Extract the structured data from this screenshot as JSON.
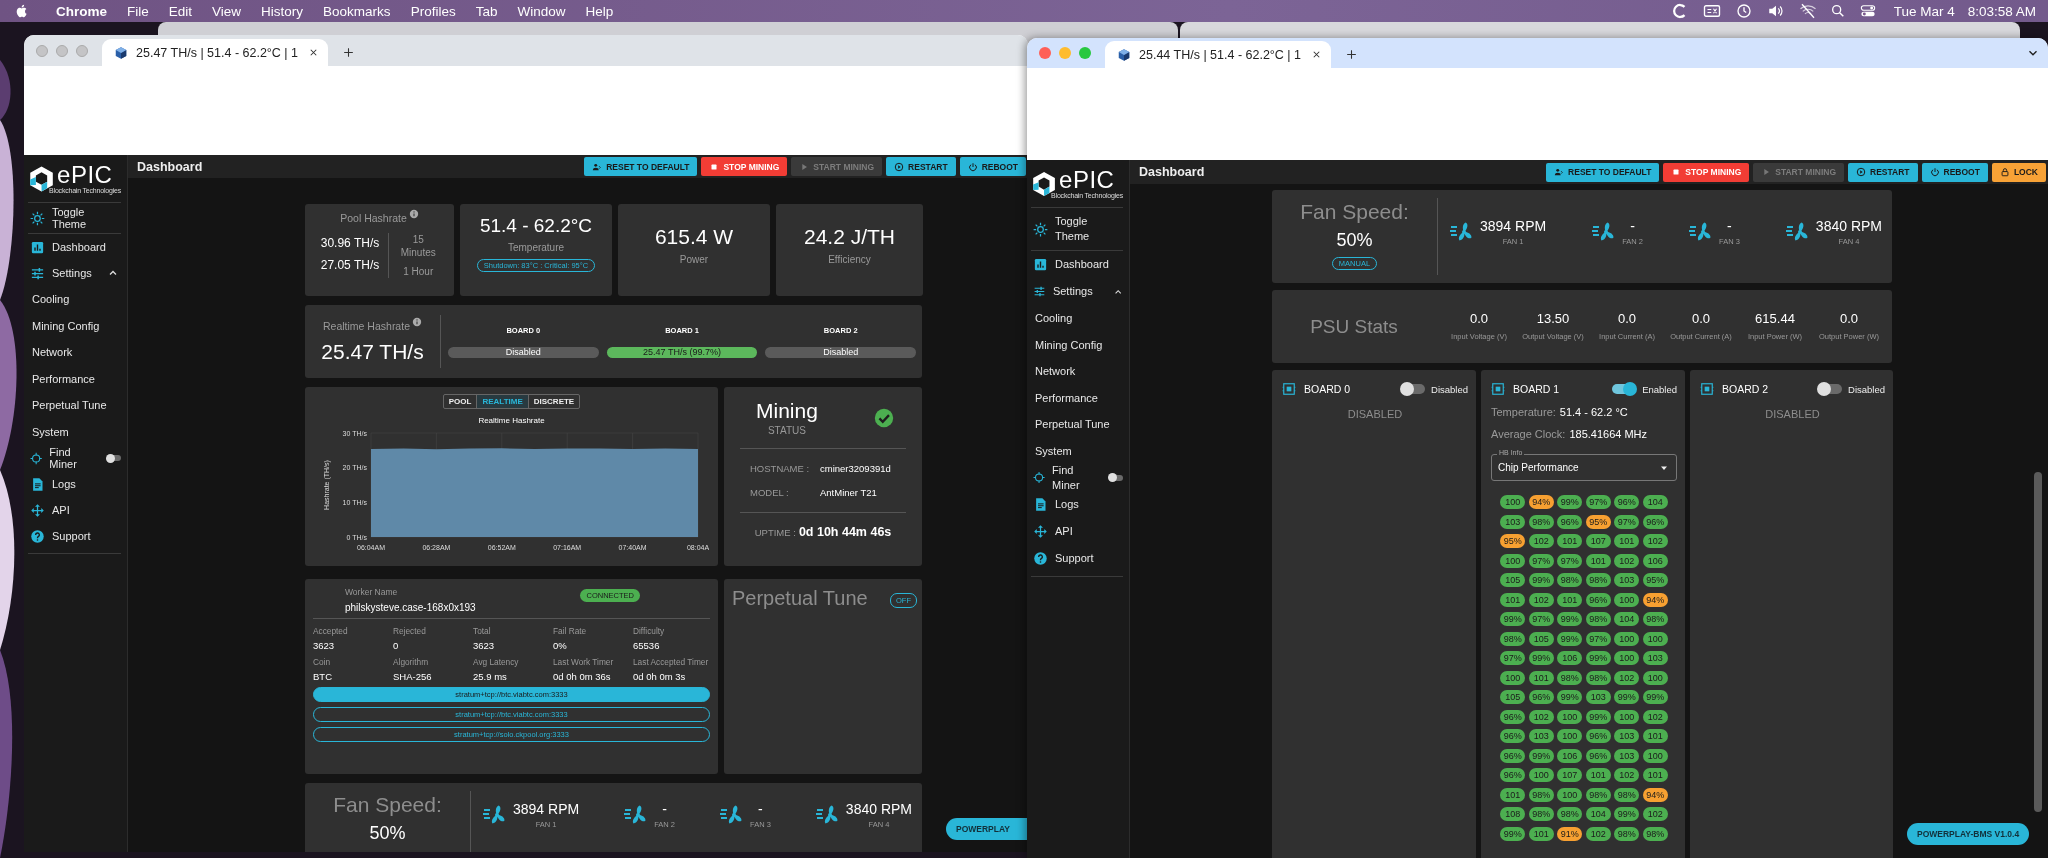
{
  "menu_bar": {
    "app_name": "Chrome",
    "menus": [
      "File",
      "Edit",
      "View",
      "History",
      "Bookmarks",
      "Profiles",
      "Tab",
      "Window",
      "Help"
    ],
    "date": "Tue Mar 4",
    "time": "8:03:58 AM"
  },
  "left_window": {
    "active": false,
    "tab_title": "25.47 TH/s | 51.4 - 62.2°C | 1",
    "app": {
      "logo": "ePIC",
      "logo_tagline": "Blockchain Technologies",
      "page_title": "Dashboard",
      "buttons": [
        {
          "label": "RESET TO DEFAULT",
          "kind": "primary"
        },
        {
          "label": "STOP MINING",
          "kind": "danger"
        },
        {
          "label": "START MINING",
          "kind": "disabled"
        },
        {
          "label": "RESTART",
          "kind": "primary"
        },
        {
          "label": "REBOOT",
          "kind": "primary"
        }
      ],
      "sidebar": [
        {
          "label": "Toggle Theme",
          "kind": "link"
        },
        {
          "label": "Dashboard",
          "kind": "link"
        },
        {
          "label": "Settings",
          "kind": "group",
          "expanded": true,
          "children": [
            {
              "label": "Cooling"
            },
            {
              "label": "Mining Config"
            },
            {
              "label": "Network"
            },
            {
              "label": "Performance"
            },
            {
              "label": "Perpetual Tune"
            },
            {
              "label": "System"
            }
          ]
        },
        {
          "label": "Find Miner",
          "kind": "toggle",
          "on": false
        },
        {
          "label": "Logs",
          "kind": "link"
        },
        {
          "label": "API",
          "kind": "link"
        },
        {
          "label": "Support",
          "kind": "link"
        }
      ],
      "pool_hashrate": {
        "label": "Pool Hashrate",
        "values": [
          "30.96 TH/s",
          "27.05 TH/s"
        ],
        "periods": [
          "15 Minutes",
          "1 Hour"
        ]
      },
      "temperature": {
        "value": "51.4 - 62.2°C",
        "label": "Temperature",
        "limits": "Shutdown: 83°C : Critical: 95°C"
      },
      "power": {
        "value": "615.4 W",
        "label": "Power"
      },
      "efficiency": {
        "value": "24.2 J/TH",
        "label": "Efficiency"
      },
      "realtime_hashrate": {
        "label": "Realtime Hashrate",
        "value": "25.47 TH/s",
        "boards": [
          {
            "name": "BOARD 0",
            "status": "Disabled",
            "enabled": false
          },
          {
            "name": "BOARD 1",
            "status": "25.47 TH/s (99.7%)",
            "enabled": true
          },
          {
            "name": "BOARD 2",
            "status": "Disabled",
            "enabled": false
          }
        ]
      },
      "chart_tabs": [
        {
          "label": "POOL",
          "selected": false
        },
        {
          "label": "REALTIME",
          "selected": true
        },
        {
          "label": "DISCRETE",
          "selected": false
        }
      ],
      "chart_data": {
        "type": "area",
        "title": "Realtime Hashrate",
        "ylabel": "Hashrate (TH/s)",
        "categories": [
          "06:04AM",
          null,
          "06:28AM",
          null,
          "06:52AM",
          null,
          "07:16AM",
          null,
          "07:40AM",
          null,
          "08:04A"
        ],
        "series": [
          {
            "color": "#5f89a8",
            "values": [
              25.4,
              25.5,
              25.3,
              25.5,
              25.6,
              25.4,
              25.5,
              25.5,
              25.4,
              25.5,
              25.4
            ]
          }
        ],
        "ylim": [
          0,
          30
        ],
        "grid": true,
        "yticks": [
          {
            "value": 0,
            "label": "0 TH/s"
          },
          {
            "value": 10,
            "label": "10 TH/s"
          },
          {
            "value": 20,
            "label": "20 TH/s"
          },
          {
            "value": 30,
            "label": "30 TH/s"
          }
        ]
      },
      "status": {
        "state": "Mining",
        "label": "STATUS",
        "ok": true,
        "hostname_label": "HOSTNAME :",
        "hostname": "cminer3209391d",
        "model_label": "MODEL :",
        "model": "AntMiner T21",
        "uptime_label": "UPTIME :",
        "uptime": "0d 10h 44m 46s"
      },
      "worker": {
        "label": "Worker Name",
        "name": "philskysteve.case-168x0x193",
        "connection": "CONNECTED",
        "connected": true,
        "stats": [
          {
            "label": "Accepted",
            "value": "3623"
          },
          {
            "label": "Rejected",
            "value": "0"
          },
          {
            "label": "Total",
            "value": "3623"
          },
          {
            "label": "Fail Rate",
            "value": "0%"
          },
          {
            "label": "Difficulty",
            "value": "65536"
          },
          {
            "label": "Coin",
            "value": "BTC"
          },
          {
            "label": "Algorithm",
            "value": "SHA-256"
          },
          {
            "label": "Avg Latency",
            "value": "25.9 ms"
          },
          {
            "label": "Last Work Timer",
            "value": "0d 0h 0m 36s"
          },
          {
            "label": "Last Accepted Timer",
            "value": "0d 0h 0m 3s"
          }
        ],
        "pools": [
          {
            "url": "stratum+tcp://btc.viabtc.com:3333",
            "selected": true
          },
          {
            "url": "stratum+tcp://btc.viabtc.com:3333",
            "selected": false
          },
          {
            "url": "stratum+tcp://solo.ckpool.org:3333",
            "selected": false
          }
        ]
      },
      "perpetual_tune": {
        "title": "Perpetual Tune",
        "state": "OFF",
        "on": false
      },
      "fans": {
        "title": "Fan Speed:",
        "value": "50%",
        "units": [
          {
            "rpm": "3894 RPM",
            "name": "FAN 1"
          },
          {
            "rpm": "-",
            "name": "FAN 2"
          },
          {
            "rpm": "-",
            "name": "FAN 3"
          },
          {
            "rpm": "3840 RPM",
            "name": "FAN 4"
          }
        ]
      },
      "version_badge": "POWERPLAY"
    }
  },
  "right_window": {
    "active": true,
    "tab_title": "25.44 TH/s | 51.4 - 62.2°C | 1",
    "app": {
      "logo": "ePIC",
      "logo_tagline": "Blockchain Technologies",
      "page_title": "Dashboard",
      "buttons": [
        {
          "label": "RESET TO DEFAULT",
          "kind": "primary"
        },
        {
          "label": "STOP MINING",
          "kind": "danger"
        },
        {
          "label": "START MINING",
          "kind": "disabled"
        },
        {
          "label": "RESTART",
          "kind": "primary"
        },
        {
          "label": "REBOOT",
          "kind": "primary"
        },
        {
          "label": "LOCK",
          "kind": "warning"
        }
      ],
      "sidebar": [
        {
          "label": "Toggle Theme",
          "kind": "link"
        },
        {
          "label": "Dashboard",
          "kind": "link"
        },
        {
          "label": "Settings",
          "kind": "group",
          "expanded": true,
          "children": [
            {
              "label": "Cooling"
            },
            {
              "label": "Mining Config"
            },
            {
              "label": "Network"
            },
            {
              "label": "Performance"
            },
            {
              "label": "Perpetual Tune"
            },
            {
              "label": "System"
            }
          ]
        },
        {
          "label": "Find Miner",
          "kind": "toggle",
          "on": false
        },
        {
          "label": "Logs",
          "kind": "link"
        },
        {
          "label": "API",
          "kind": "link"
        },
        {
          "label": "Support",
          "kind": "link"
        }
      ],
      "fans": {
        "title": "Fan Speed:",
        "value": "50%",
        "mode": "MANUAL",
        "units": [
          {
            "rpm": "3894 RPM",
            "name": "FAN 1"
          },
          {
            "rpm": "-",
            "name": "FAN 2"
          },
          {
            "rpm": "-",
            "name": "FAN 3"
          },
          {
            "rpm": "3840 RPM",
            "name": "FAN 4"
          }
        ]
      },
      "psu": {
        "title": "PSU Stats",
        "stats": [
          {
            "value": "0.0",
            "label": "Input Voltage (V)"
          },
          {
            "value": "13.50",
            "label": "Output Voltage (V)"
          },
          {
            "value": "0.0",
            "label": "Input Current (A)"
          },
          {
            "value": "0.0",
            "label": "Output Current (A)"
          },
          {
            "value": "615.44",
            "label": "Input Power (W)"
          },
          {
            "value": "0.0",
            "label": "Output Power (W)"
          }
        ]
      },
      "boards": [
        {
          "name": "BOARD 0",
          "enabled": false,
          "toggle_label": "Disabled",
          "message": "DISABLED"
        },
        {
          "name": "BOARD 1",
          "enabled": true,
          "toggle_label": "Enabled",
          "temperature_label": "Temperature:",
          "temperature": "51.4 - 62.2 °C",
          "clock_label": "Average Clock:",
          "clock": "185.41664 MHz",
          "select_label": "HB Info",
          "select_value": "Chip Performance",
          "chips": [
            [
              {
                "value": "100",
                "low": false
              },
              {
                "value": "94%",
                "low": true
              },
              {
                "value": "99%",
                "low": false
              },
              {
                "value": "97%",
                "low": false
              },
              {
                "value": "96%",
                "low": false
              },
              {
                "value": "104",
                "low": false
              }
            ],
            [
              {
                "value": "103",
                "low": false
              },
              {
                "value": "98%",
                "low": false
              },
              {
                "value": "96%",
                "low": false
              },
              {
                "value": "95%",
                "low": true
              },
              {
                "value": "97%",
                "low": false
              },
              {
                "value": "96%",
                "low": false
              }
            ],
            [
              {
                "value": "95%",
                "low": true
              },
              {
                "value": "102",
                "low": false
              },
              {
                "value": "101",
                "low": false
              },
              {
                "value": "107",
                "low": false
              },
              {
                "value": "101",
                "low": false
              },
              {
                "value": "102",
                "low": false
              }
            ],
            [
              {
                "value": "100",
                "low": false
              },
              {
                "value": "97%",
                "low": false
              },
              {
                "value": "97%",
                "low": false
              },
              {
                "value": "101",
                "low": false
              },
              {
                "value": "102",
                "low": false
              },
              {
                "value": "106",
                "low": false
              }
            ],
            [
              {
                "value": "105",
                "low": false
              },
              {
                "value": "99%",
                "low": false
              },
              {
                "value": "98%",
                "low": false
              },
              {
                "value": "98%",
                "low": false
              },
              {
                "value": "103",
                "low": false
              },
              {
                "value": "95%",
                "low": false
              }
            ],
            [
              {
                "value": "101",
                "low": false
              },
              {
                "value": "102",
                "low": false
              },
              {
                "value": "101",
                "low": false
              },
              {
                "value": "96%",
                "low": false
              },
              {
                "value": "100",
                "low": false
              },
              {
                "value": "94%",
                "low": true
              }
            ],
            [
              {
                "value": "99%",
                "low": false
              },
              {
                "value": "97%",
                "low": false
              },
              {
                "value": "99%",
                "low": false
              },
              {
                "value": "98%",
                "low": false
              },
              {
                "value": "104",
                "low": false
              },
              {
                "value": "98%",
                "low": false
              }
            ],
            [
              {
                "value": "98%",
                "low": false
              },
              {
                "value": "105",
                "low": false
              },
              {
                "value": "99%",
                "low": false
              },
              {
                "value": "97%",
                "low": false
              },
              {
                "value": "100",
                "low": false
              },
              {
                "value": "100",
                "low": false
              }
            ],
            [
              {
                "value": "97%",
                "low": false
              },
              {
                "value": "99%",
                "low": false
              },
              {
                "value": "106",
                "low": false
              },
              {
                "value": "99%",
                "low": false
              },
              {
                "value": "100",
                "low": false
              },
              {
                "value": "103",
                "low": false
              }
            ],
            [
              {
                "value": "100",
                "low": false
              },
              {
                "value": "101",
                "low": false
              },
              {
                "value": "98%",
                "low": false
              },
              {
                "value": "98%",
                "low": false
              },
              {
                "value": "102",
                "low": false
              },
              {
                "value": "100",
                "low": false
              }
            ],
            [
              {
                "value": "105",
                "low": false
              },
              {
                "value": "96%",
                "low": false
              },
              {
                "value": "99%",
                "low": false
              },
              {
                "value": "103",
                "low": false
              },
              {
                "value": "99%",
                "low": false
              },
              {
                "value": "99%",
                "low": false
              }
            ],
            [
              {
                "value": "96%",
                "low": false
              },
              {
                "value": "102",
                "low": false
              },
              {
                "value": "100",
                "low": false
              },
              {
                "value": "99%",
                "low": false
              },
              {
                "value": "100",
                "low": false
              },
              {
                "value": "102",
                "low": false
              }
            ],
            [
              {
                "value": "96%",
                "low": false
              },
              {
                "value": "103",
                "low": false
              },
              {
                "value": "100",
                "low": false
              },
              {
                "value": "96%",
                "low": false
              },
              {
                "value": "103",
                "low": false
              },
              {
                "value": "101",
                "low": false
              }
            ],
            [
              {
                "value": "96%",
                "low": false
              },
              {
                "value": "99%",
                "low": false
              },
              {
                "value": "106",
                "low": false
              },
              {
                "value": "96%",
                "low": false
              },
              {
                "value": "103",
                "low": false
              },
              {
                "value": "100",
                "low": false
              }
            ],
            [
              {
                "value": "96%",
                "low": false
              },
              {
                "value": "100",
                "low": false
              },
              {
                "value": "107",
                "low": false
              },
              {
                "value": "101",
                "low": false
              },
              {
                "value": "102",
                "low": false
              },
              {
                "value": "101",
                "low": false
              }
            ],
            [
              {
                "value": "101",
                "low": false
              },
              {
                "value": "98%",
                "low": false
              },
              {
                "value": "100",
                "low": false
              },
              {
                "value": "98%",
                "low": false
              },
              {
                "value": "98%",
                "low": false
              },
              {
                "value": "94%",
                "low": true
              }
            ],
            [
              {
                "value": "108",
                "low": false
              },
              {
                "value": "98%",
                "low": false
              },
              {
                "value": "98%",
                "low": false
              },
              {
                "value": "104",
                "low": false
              },
              {
                "value": "99%",
                "low": false
              },
              {
                "value": "102",
                "low": false
              }
            ],
            [
              {
                "value": "99%",
                "low": false
              },
              {
                "value": "101",
                "low": false
              },
              {
                "value": "91%",
                "low": true
              },
              {
                "value": "102",
                "low": false
              },
              {
                "value": "98%",
                "low": false
              },
              {
                "value": "98%",
                "low": false
              }
            ]
          ]
        },
        {
          "name": "BOARD 2",
          "enabled": false,
          "toggle_label": "Disabled",
          "message": "DISABLED"
        }
      ],
      "version_badge": "POWERPLAY-BMS V1.0.4"
    }
  }
}
